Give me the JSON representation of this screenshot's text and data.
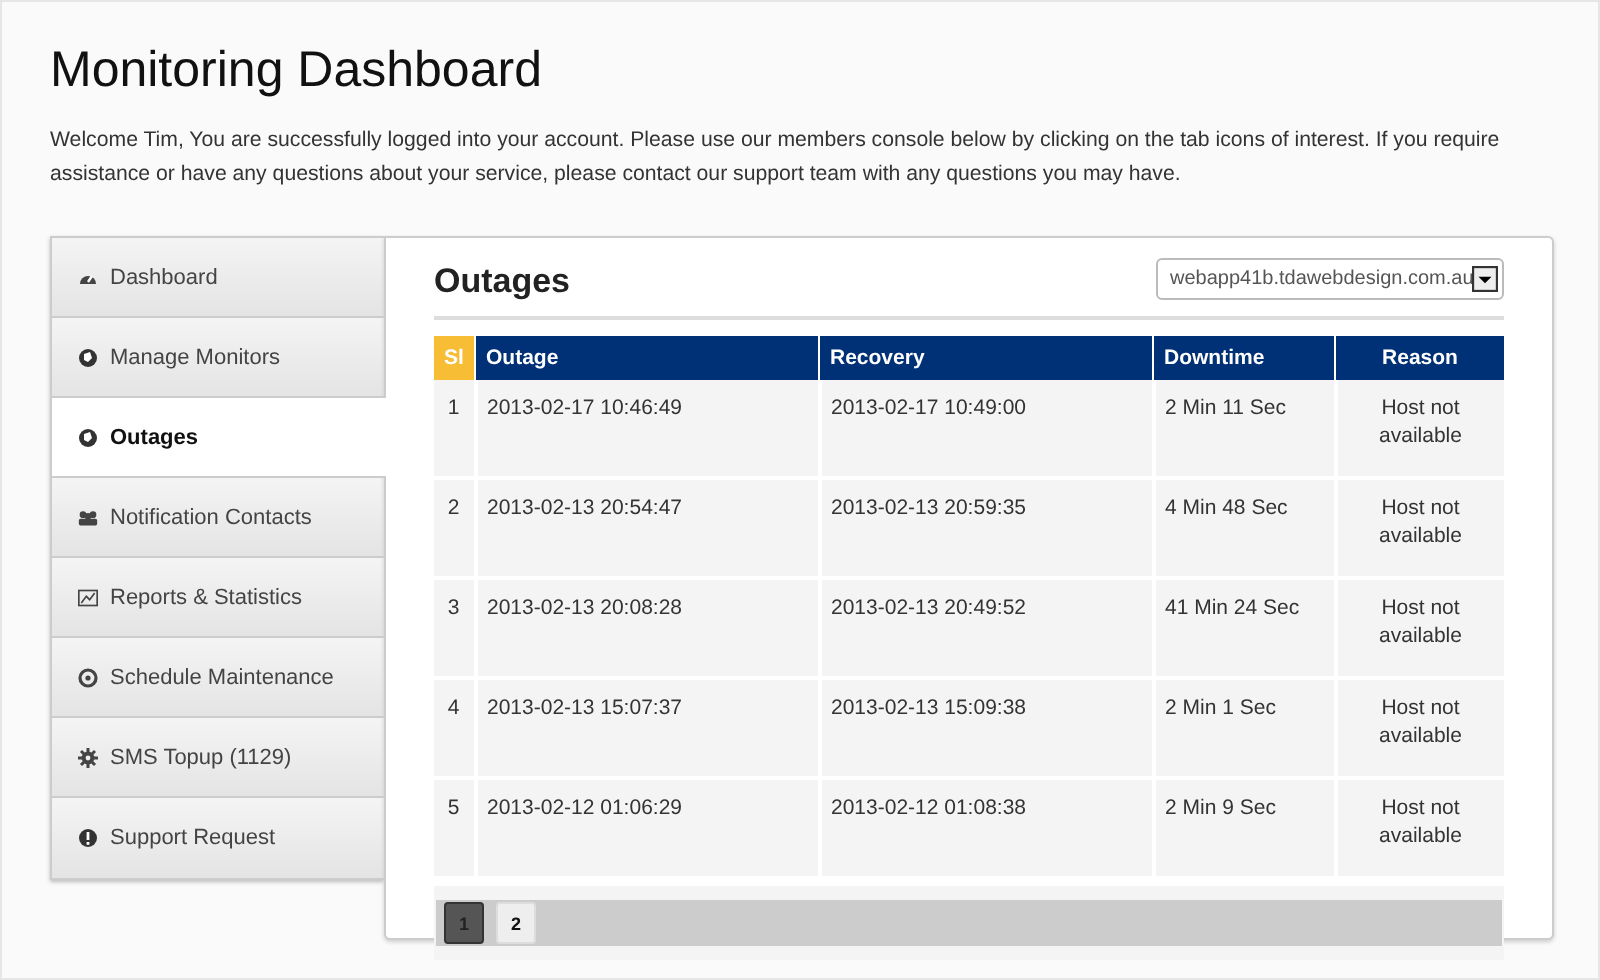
{
  "page_title": "Monitoring Dashboard",
  "welcome": "Welcome Tim, You are successfully logged into your account. Please use our members console below by clicking on the tab icons of interest. If you require assistance or have any questions about your service, please contact our support team with any questions you may have.",
  "sidebar": {
    "items": [
      {
        "label": "Dashboard",
        "selected": false
      },
      {
        "label": "Manage Monitors",
        "selected": false
      },
      {
        "label": "Outages",
        "selected": true
      },
      {
        "label": "Notification Contacts",
        "selected": false
      },
      {
        "label": "Reports & Statistics",
        "selected": false
      },
      {
        "label": "Schedule Maintenance",
        "selected": false
      },
      {
        "label": "SMS Topup (1129)",
        "selected": false
      },
      {
        "label": "Support Request",
        "selected": false
      }
    ]
  },
  "panel": {
    "title": "Outages",
    "site_select": {
      "value": "webapp41b.tdawebdesign.com.au"
    }
  },
  "table": {
    "columns": [
      "Sl",
      "Outage",
      "Recovery",
      "Downtime",
      "Reason"
    ],
    "rows": [
      [
        "1",
        "2013-02-17 10:46:49",
        "2013-02-17 10:49:00",
        "2 Min 11 Sec",
        "Host not available"
      ],
      [
        "2",
        "2013-02-13 20:54:47",
        "2013-02-13 20:59:35",
        "4 Min 48 Sec",
        "Host not available"
      ],
      [
        "3",
        "2013-02-13 20:08:28",
        "2013-02-13 20:49:52",
        "41 Min 24 Sec",
        "Host not available"
      ],
      [
        "4",
        "2013-02-13 15:07:37",
        "2013-02-13 15:09:38",
        "2 Min 1 Sec",
        "Host not available"
      ],
      [
        "5",
        "2013-02-12 01:06:29",
        "2013-02-12 01:08:38",
        "2 Min 9 Sec",
        "Host not available"
      ]
    ]
  },
  "pagination": [
    {
      "label": "1",
      "selected": true
    },
    {
      "label": "2",
      "selected": false
    }
  ]
}
